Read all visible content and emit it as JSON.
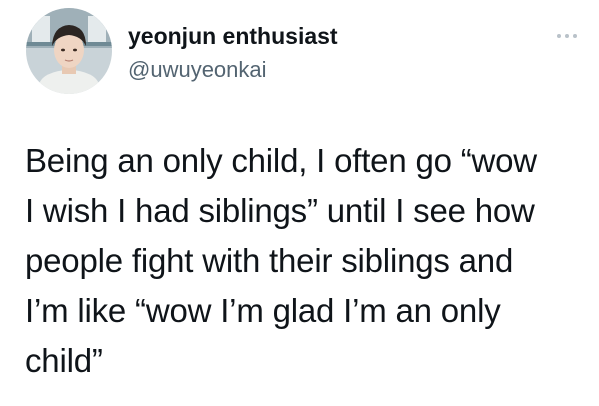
{
  "author": {
    "display_name": "yeonjun enthusiast",
    "handle": "@uwuyeonkai",
    "avatar": "profile-photo"
  },
  "menu": {
    "icon": "more-icon"
  },
  "tweet": {
    "text": "Being an only child, I often go “wow\nI wish I had siblings” until I see how\npeople fight with their siblings and\nI’m like “wow I’m glad I’m an only\nchild”"
  },
  "colors": {
    "text": "#0f1419",
    "secondary": "#536471",
    "background": "#ffffff"
  }
}
